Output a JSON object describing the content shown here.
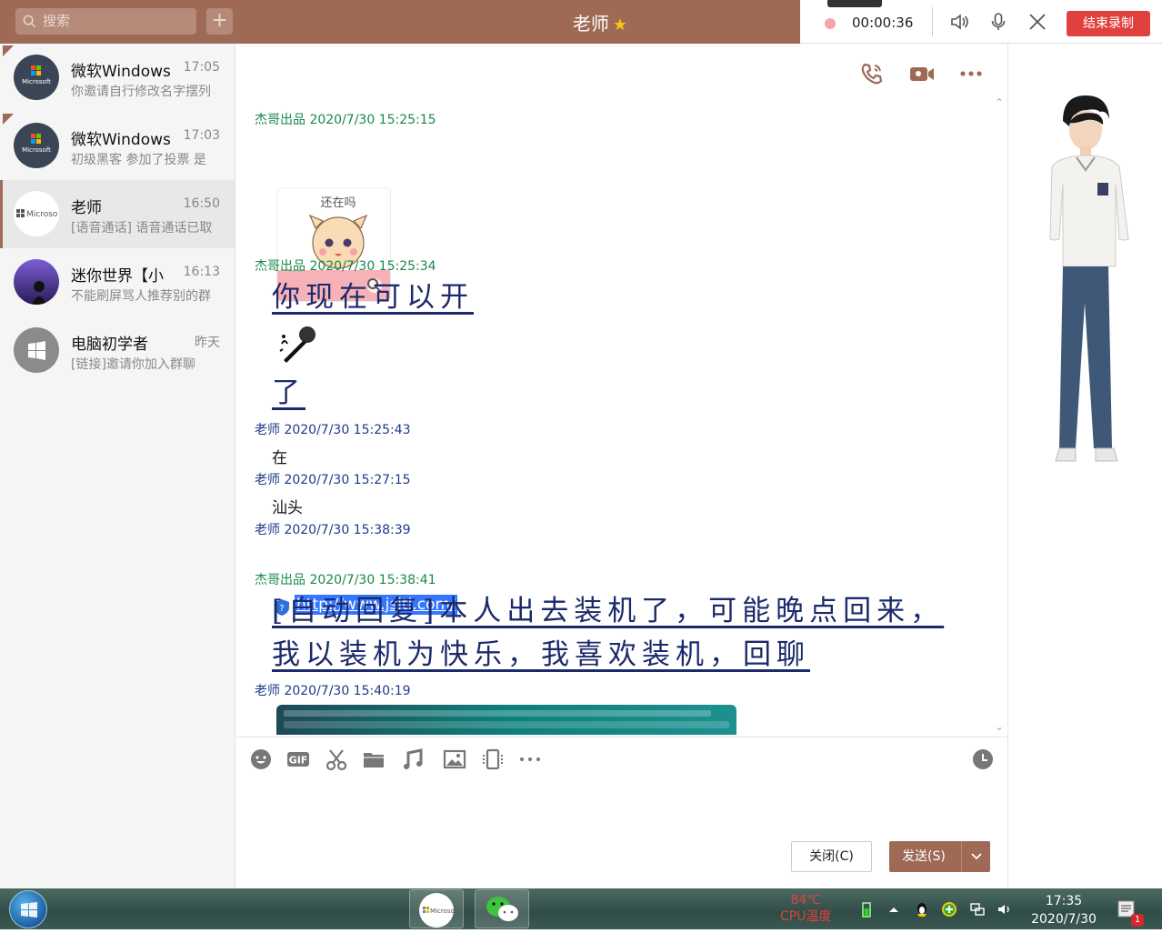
{
  "header": {
    "search_placeholder": "搜索",
    "add_label": "+",
    "chat_title": "老师"
  },
  "recording": {
    "time": "00:00:36",
    "end_label": "结束录制"
  },
  "conversations": [
    {
      "name": "微软Windows",
      "time": "17:05",
      "preview": "你邀请自行修改名字摆列"
    },
    {
      "name": "微软Windows",
      "time": "17:03",
      "preview": "初级黑客 参加了投票 是"
    },
    {
      "name": "老师",
      "time": "16:50",
      "preview": "[语音通话] 语音通话已取"
    },
    {
      "name": "迷你世界【小",
      "time": "16:13",
      "preview": "不能刷屏骂人推荐别的群"
    },
    {
      "name": "电脑初学者",
      "time": "昨天",
      "preview": "[链接]邀请你加入群聊"
    }
  ],
  "messages": {
    "m1_meta": "杰哥出品 2020/7/30 15:25:15",
    "sticker_text": "还在吗",
    "m2_meta": "杰哥出品 2020/7/30 15:25:34",
    "m2_line1": "你现在可以开",
    "m2_line2": "了",
    "m3_meta": "老师 2020/7/30 15:25:43",
    "m3_text": "在",
    "m4_meta": "老师 2020/7/30 15:27:15",
    "m4_text": "汕头",
    "m5_meta": "老师 2020/7/30 15:38:39",
    "m5_link": "http://www.jsitl.com/",
    "m6_meta": "杰哥出品 2020/7/30 15:38:41",
    "m6_line1": "[自动回复]本人出去装机了，可能晚点回来，",
    "m6_line2": "我以装机为快乐，我喜欢装机，回聊",
    "m7_meta": "老师 2020/7/30 15:40:19"
  },
  "input": {
    "close_label": "关闭(C)",
    "send_label": "发送(S)"
  },
  "taskbar": {
    "cpu_temp": "84℃",
    "cpu_label": "CPU温度",
    "time": "17:35",
    "date": "2020/7/30",
    "notification_count": "1"
  },
  "colors": {
    "brand": "#9e6a55",
    "record_end": "#e0413f",
    "my_name": "#168a4a",
    "other_name": "#1e3a8a",
    "handwriting": "#1c2a6b"
  }
}
